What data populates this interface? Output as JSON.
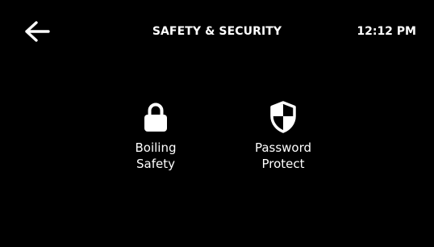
{
  "header": {
    "title": "SAFETY & SECURITY",
    "time": "12:12 PM",
    "back_icon": "arrow-left-icon"
  },
  "tiles": [
    {
      "label": "Boiling\nSafety",
      "icon": "lock-icon"
    },
    {
      "label": "Password\nProtect",
      "icon": "shield-icon"
    }
  ],
  "colors": {
    "background": "#000000",
    "foreground": "#ffffff"
  }
}
